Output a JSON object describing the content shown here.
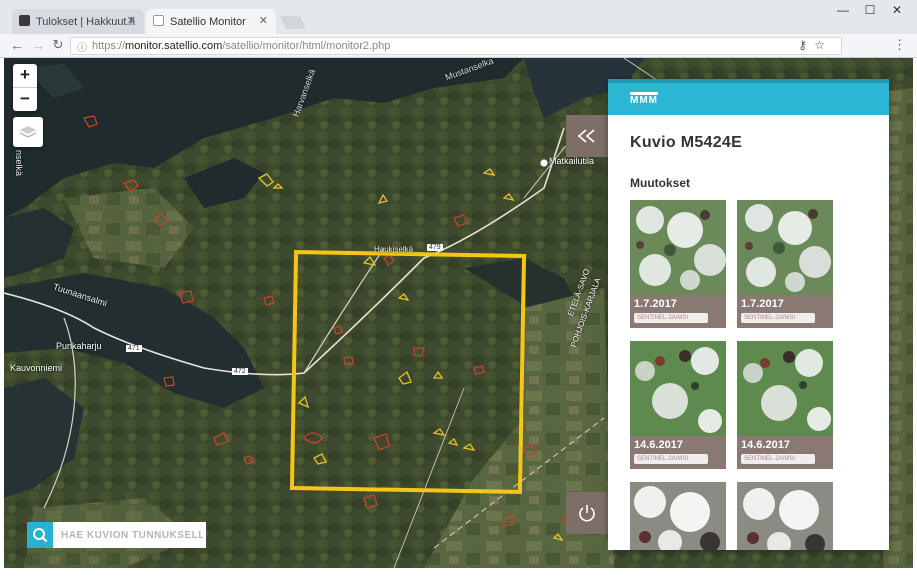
{
  "browser": {
    "tabs": [
      {
        "title": "Tulokset | Hakkuut.fi",
        "active": false,
        "favicon_color": "#3a3a3a"
      },
      {
        "title": "Satellio Monitor",
        "active": true,
        "favicon_color": "#ffffff"
      }
    ],
    "url": {
      "scheme": "https://",
      "domain": "monitor.satellio.com",
      "path": "/satellio/monitor/html/monitor2.php"
    },
    "icons": {
      "back": "arrow-left-icon",
      "forward": "arrow-right-icon",
      "reload": "reload-icon",
      "key": "key-icon",
      "star": "star-icon",
      "menu": "kebab-menu-icon"
    }
  },
  "map": {
    "zoom_in": "+",
    "zoom_out": "−",
    "place_labels": [
      {
        "text": "Tuunaansalmi"
      },
      {
        "text": "Punkaharju"
      },
      {
        "text": "Kauvonniemi"
      },
      {
        "text": "Matkailutila"
      },
      {
        "text": "Harvanselkä"
      },
      {
        "text": "Mustanselka"
      },
      {
        "text": "Haukiselkä"
      },
      {
        "text": "ETELÄ-SAVO"
      },
      {
        "text": "POHJOIS-KARJALA"
      },
      {
        "text": "nselkä"
      }
    ],
    "road_labels": [
      "471",
      "479",
      "472"
    ],
    "highlight_color": "#f5c518",
    "change_colors": {
      "red": "#c9432b",
      "yellow": "#e8c12a"
    }
  },
  "search": {
    "placeholder": "HAE KUVION TUNNUKSELLA",
    "accent": "#27b2cf"
  },
  "panel": {
    "brand_color": "#2bb6d3",
    "logo_text": "MMM",
    "title": "Kuvio M5424E",
    "section_title": "Muutokset",
    "thumbnails": [
      {
        "date": "1.7.2017",
        "tag": "SENTINEL-2A/MSI"
      },
      {
        "date": "1.7.2017",
        "tag": "SENTINEL-2A/MSI"
      },
      {
        "date": "14.6.2017",
        "tag": "SENTINEL-2A/MSI"
      },
      {
        "date": "14.6.2017",
        "tag": "SENTINEL-2A/MSI"
      },
      {
        "date": "",
        "tag": ""
      },
      {
        "date": "",
        "tag": ""
      }
    ]
  }
}
